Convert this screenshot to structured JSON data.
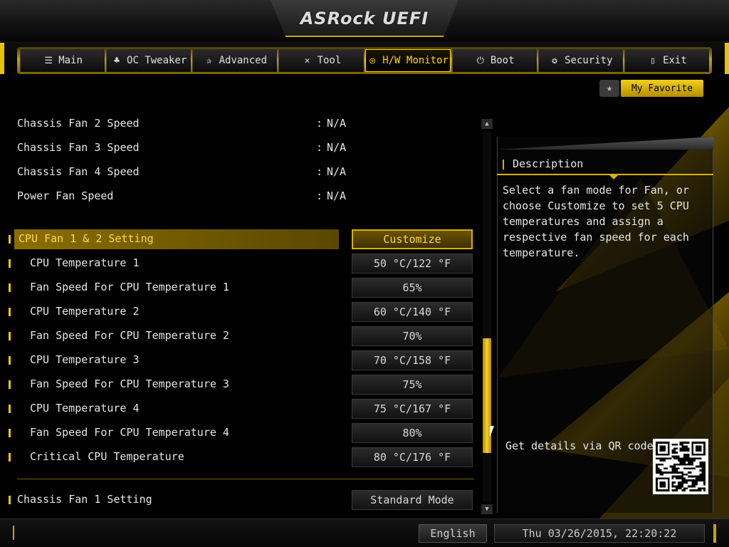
{
  "header": {
    "title": "ASRock UEFI"
  },
  "tabs": [
    {
      "label": "Main",
      "icon": "list-icon",
      "glyph": "☰"
    },
    {
      "label": "OC Tweaker",
      "icon": "rocket-icon",
      "glyph": "♣"
    },
    {
      "label": "Advanced",
      "icon": "star-icon",
      "glyph": "✰"
    },
    {
      "label": "Tool",
      "icon": "wrench-icon",
      "glyph": "✕"
    },
    {
      "label": "H/W Monitor",
      "icon": "monitor-icon",
      "glyph": "◎",
      "active": true
    },
    {
      "label": "Boot",
      "icon": "power-icon",
      "glyph": "⏻"
    },
    {
      "label": "Security",
      "icon": "shield-icon",
      "glyph": "✪"
    },
    {
      "label": "Exit",
      "icon": "door-icon",
      "glyph": "▯"
    }
  ],
  "favorite": {
    "label": "My Favorite",
    "icon": "star-icon"
  },
  "readings": [
    {
      "label": "Chassis Fan 2 Speed",
      "value": "N/A"
    },
    {
      "label": "Chassis Fan 3 Speed",
      "value": "N/A"
    },
    {
      "label": "Chassis Fan 4 Speed",
      "value": "N/A"
    },
    {
      "label": "Power Fan Speed",
      "value": "N/A"
    }
  ],
  "settings": [
    {
      "label": "CPU Fan 1 & 2 Setting",
      "value": "Customize",
      "selected": true
    },
    {
      "label": "CPU Temperature 1",
      "value": "50 °C/122 °F",
      "indent": true
    },
    {
      "label": "Fan Speed For CPU Temperature 1",
      "value": "65%",
      "indent": true
    },
    {
      "label": "CPU Temperature 2",
      "value": "60 °C/140 °F",
      "indent": true
    },
    {
      "label": "Fan Speed For CPU Temperature 2",
      "value": "70%",
      "indent": true
    },
    {
      "label": "CPU Temperature 3",
      "value": "70 °C/158 °F",
      "indent": true
    },
    {
      "label": "Fan Speed For CPU Temperature 3",
      "value": "75%",
      "indent": true
    },
    {
      "label": "CPU Temperature 4",
      "value": "75 °C/167 °F",
      "indent": true
    },
    {
      "label": "Fan Speed For CPU Temperature 4",
      "value": "80%",
      "indent": true
    },
    {
      "label": "Critical CPU Temperature",
      "value": "80 °C/176 °F",
      "indent": true
    },
    {
      "label": "Chassis Fan 1 Setting",
      "value": "Standard Mode"
    }
  ],
  "scrollbar": {
    "thumb_start": 0.56,
    "thumb_size": 0.31
  },
  "description": {
    "title": "Description",
    "text": "Select a fan mode for Fan, or choose Customize to set 5 CPU temperatures and assign a respective fan speed for each temperature.",
    "qr_label": "Get details via QR code"
  },
  "footer": {
    "language": "English",
    "datetime": "Thu 03/26/2015, 22:20:22"
  },
  "colors": {
    "accent": "#f0c800",
    "highlight": "#8a6e00",
    "background": "#000000"
  }
}
